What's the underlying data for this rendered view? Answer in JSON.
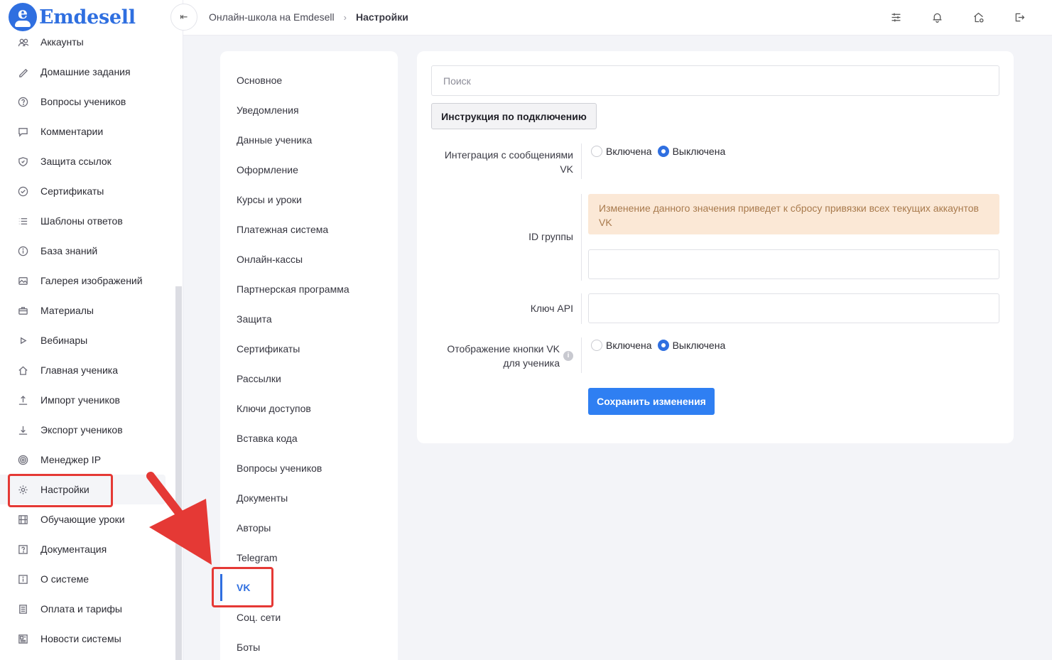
{
  "brand": {
    "name": "Emdesell",
    "mark_letter": "e",
    "color": "#2f6fe0"
  },
  "sidebar": {
    "items": [
      {
        "label": "Аккаунты",
        "icon": "users-icon"
      },
      {
        "label": "Домашние задания",
        "icon": "pencil-icon"
      },
      {
        "label": "Вопросы учеников",
        "icon": "question-circle-icon"
      },
      {
        "label": "Комментарии",
        "icon": "comment-icon"
      },
      {
        "label": "Защита ссылок",
        "icon": "shield-icon"
      },
      {
        "label": "Сертификаты",
        "icon": "check-circle-icon"
      },
      {
        "label": "Шаблоны ответов",
        "icon": "list-icon"
      },
      {
        "label": "База знаний",
        "icon": "info-circle-icon"
      },
      {
        "label": "Галерея изображений",
        "icon": "image-icon"
      },
      {
        "label": "Материалы",
        "icon": "briefcase-icon"
      },
      {
        "label": "Вебинары",
        "icon": "play-icon"
      },
      {
        "label": "Главная ученика",
        "icon": "home-icon"
      },
      {
        "label": "Импорт учеников",
        "icon": "upload-icon"
      },
      {
        "label": "Экспорт учеников",
        "icon": "download-icon"
      },
      {
        "label": "Менеджер IP",
        "icon": "target-icon"
      },
      {
        "label": "Настройки",
        "icon": "gear-icon",
        "active": true
      },
      {
        "label": "Обучающие уроки",
        "icon": "film-icon"
      },
      {
        "label": "Документация",
        "icon": "question-square-icon"
      },
      {
        "label": "О системе",
        "icon": "info-square-icon"
      },
      {
        "label": "Оплата и тарифы",
        "icon": "receipt-icon"
      },
      {
        "label": "Новости системы",
        "icon": "news-icon"
      }
    ]
  },
  "topbar": {
    "breadcrumb": {
      "parent": "Онлайн-школа на Emdesell",
      "current": "Настройки"
    },
    "icons": [
      "sliders-icon",
      "bell-icon",
      "home-settings-icon",
      "logout-icon"
    ]
  },
  "settings_menu": {
    "items": [
      "Основное",
      "Уведомления",
      "Данные ученика",
      "Оформление",
      "Курсы и уроки",
      "Платежная система",
      "Онлайн-кассы",
      "Партнерская программа",
      "Защита",
      "Сертификаты",
      "Рассылки",
      "Ключи доступов",
      "Вставка кода",
      "Вопросы учеников",
      "Документы",
      "Авторы",
      "Telegram",
      "VK",
      "Соц. сети",
      "Боты"
    ],
    "active": "VK"
  },
  "main": {
    "search_placeholder": "Поиск",
    "instruction_button": "Инструкция по подключению",
    "integration": {
      "label": "Интеграция с сообщениями VK",
      "option_on": "Включена",
      "option_off": "Выключена",
      "selected": "off"
    },
    "group_id": {
      "label": "ID группы",
      "warning": "Изменение данного значения приведет к сбросу привязки всех текущих аккаунтов VK",
      "value": ""
    },
    "api_key": {
      "label": "Ключ API",
      "value": ""
    },
    "show_button": {
      "label": "Отображение кнопки VK для ученика",
      "option_on": "Включена",
      "option_off": "Выключена",
      "selected": "off",
      "info": "i"
    },
    "save_button": "Сохранить изменения"
  },
  "colors": {
    "accent": "#2f6fe0",
    "annotation": "#e53935",
    "warning_bg": "#fbe8d6",
    "warning_text": "#a87a4d"
  }
}
